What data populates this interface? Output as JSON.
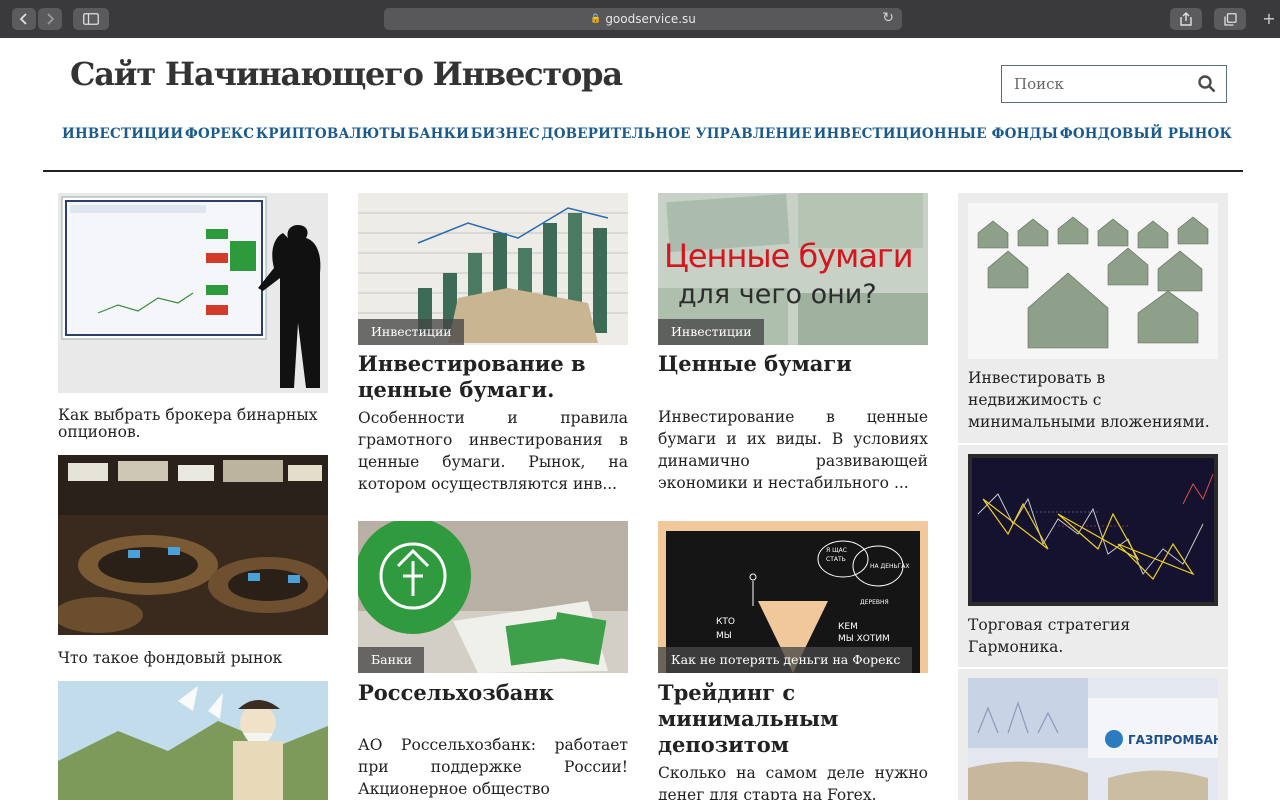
{
  "browser": {
    "url": "goodservice.su"
  },
  "site": {
    "title": "Сайт Начинающего Инвестора",
    "search_placeholder": "Поиск"
  },
  "nav": [
    {
      "label": "ИНВЕСТИЦИИ"
    },
    {
      "label": "ФОРЕКС"
    },
    {
      "label": "КРИПТОВАЛЮТЫ"
    },
    {
      "label": "БАНКИ"
    },
    {
      "label": "БИЗНЕС"
    },
    {
      "label": "ДОВЕРИТЕЛЬНОЕ УПРАВЛЕНИЕ"
    },
    {
      "label": "ИНВЕСТИЦИОННЫЕ ФОНДЫ"
    },
    {
      "label": "ФОНДОВЫЙ РЫНОК"
    }
  ],
  "left_column": [
    {
      "caption": "Как выбрать брокера бинарных опционов."
    },
    {
      "caption": "Что такое фондовый рынок"
    }
  ],
  "articles": [
    {
      "category": "Инвестиции",
      "title": "Инвестирование в ценные бумаги.",
      "excerpt": "Особенности и правила грамотного инвестирования в ценные бумаги. Рынок, на котором осуществляются инв..."
    },
    {
      "category": "Инвестиции",
      "image_text_line1": "Ценные бумаги",
      "image_text_line2": "для чего они?",
      "title": "Ценные бумаги",
      "excerpt": "Инвестирование в ценные бумаги и их виды. В условиях динамично развивающей экономики и нестабильного ..."
    },
    {
      "category": "Банки",
      "title": "Россельхозбанк",
      "excerpt": "АО Россельхозбанк: работает при поддержке России! Акционерное общество"
    },
    {
      "category": "Как не потерять деньги на Форекс",
      "image_text": [
        "КТО",
        "МЫ",
        "КЕМ",
        "МЫ ХОТИМ",
        "Я ЩАС",
        "СТАТЬ",
        "НА ДЕНЬГАХ",
        "ДЕРЕВНЯ"
      ],
      "title": "Трейдинг с минимальным депозитом",
      "excerpt": "Сколько на самом деле нужно денег для старта на Forex."
    }
  ],
  "sidebar": [
    {
      "caption": "Инвестировать в недвижимость с минимальными вложениями."
    },
    {
      "caption": "Торговая стратегия Гармоника."
    },
    {
      "image_text": "ГАЗПРОМБАНК"
    }
  ],
  "colors": {
    "nav_link": "#1a5a8c",
    "chrome_bg": "#3a3a3c",
    "sidebar_bg": "#ececec",
    "tag_bg": "#464646"
  }
}
